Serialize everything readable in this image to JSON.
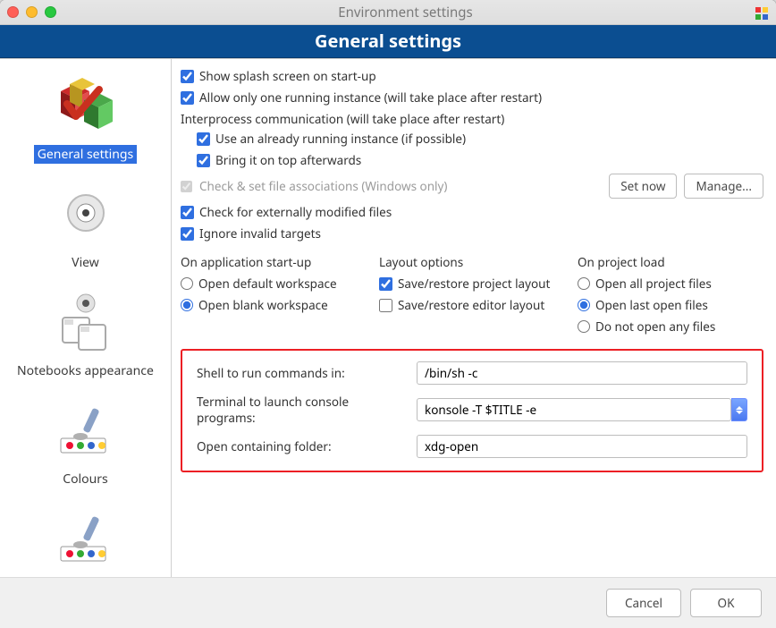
{
  "window": {
    "title": "Environment settings"
  },
  "banner": "General settings",
  "sidebar": {
    "items": [
      {
        "label": "General settings"
      },
      {
        "label": "View"
      },
      {
        "label": "Notebooks appearance"
      },
      {
        "label": "Colours"
      },
      {
        "label": ""
      }
    ]
  },
  "opts": {
    "splash": "Show splash screen on start-up",
    "one_instance": "Allow only one running instance (will take place after restart)",
    "ipc_label": "Interprocess communication (will take place after restart)",
    "use_running": "Use an already running instance (if possible)",
    "bring_top": "Bring it on top afterwards",
    "file_assoc": "Check & set file associations (Windows only)",
    "set_now": "Set now",
    "manage": "Manage...",
    "check_ext": "Check for externally modified files",
    "ignore_inv": "Ignore invalid targets"
  },
  "startup": {
    "title": "On application start-up",
    "open_default": "Open default workspace",
    "open_blank": "Open blank workspace"
  },
  "layout": {
    "title": "Layout options",
    "save_project": "Save/restore project layout",
    "save_editor": "Save/restore editor layout"
  },
  "project_load": {
    "title": "On project load",
    "open_all": "Open all project files",
    "open_last": "Open last open files",
    "open_none": "Do not open any files"
  },
  "paths": {
    "shell_label": "Shell to run commands in:",
    "shell_value": "/bin/sh -c",
    "terminal_label": "Terminal to launch console programs:",
    "terminal_value": "konsole -T $TITLE -e",
    "folder_label": "Open containing folder:",
    "folder_value": "xdg-open"
  },
  "footer": {
    "cancel": "Cancel",
    "ok": "OK"
  }
}
